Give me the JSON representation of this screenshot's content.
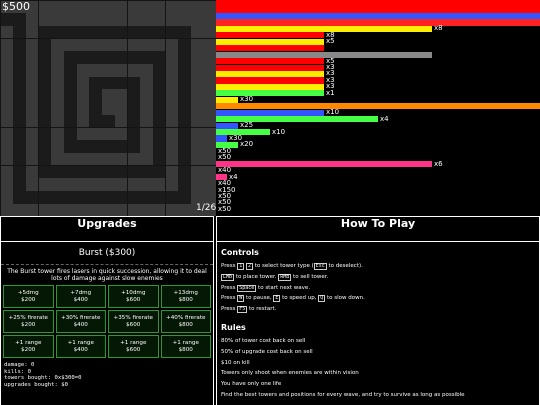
{
  "game": {
    "money": "$500",
    "wave_counter": "1/26"
  },
  "waves": [
    {
      "color": "#ff0000",
      "label": ""
    },
    {
      "color": "#ff0000",
      "label": ""
    },
    {
      "color": "#3355ff",
      "label": ""
    },
    {
      "color": "#ff2222",
      "label": ""
    },
    {
      "color": "#ffee00",
      "label": "x8"
    },
    {
      "color": "#ff0000",
      "label": "x8"
    },
    {
      "color": "#ffee00",
      "label": "x5"
    },
    {
      "color": "#ff0000",
      "label": ""
    },
    {
      "color": "#888888",
      "label": ""
    },
    {
      "color": "#ff0000",
      "label": "x5"
    },
    {
      "color": "#ff0000",
      "label": "x3"
    },
    {
      "color": "#ffee00",
      "label": "x3"
    },
    {
      "color": "#ff0000",
      "label": "x3"
    },
    {
      "color": "#ffee00",
      "label": "x3"
    },
    {
      "color": "#44ff44",
      "label": "x1"
    },
    {
      "color": "#ffee00",
      "label": "x30"
    },
    {
      "color": "#ff8800",
      "label": ""
    },
    {
      "color": "#3355ff",
      "label": "x10"
    },
    {
      "color": "#44ff44",
      "label": "x4"
    },
    {
      "color": "#3355ff",
      "label": "x25"
    },
    {
      "color": "#44ff44",
      "label": "x10"
    },
    {
      "color": "#3355ff",
      "label": "x30"
    },
    {
      "color": "#44ff44",
      "label": "x20"
    },
    {
      "color": "#3355ff",
      "label": "x50"
    },
    {
      "color": "#44ff44",
      "label": "x50"
    },
    {
      "color": "#ff3388",
      "label": "x6"
    },
    {
      "color": "#ffee00",
      "label": "x40"
    },
    {
      "color": "#ff3388",
      "label": "x4"
    },
    {
      "color": "#44ff44",
      "label": "x40"
    },
    {
      "color": "#3355ff",
      "label": "x150"
    },
    {
      "color": "#ff0000",
      "label": "x50"
    },
    {
      "color": "#ffee00",
      "label": "x50"
    },
    {
      "color": "#ffee00",
      "label": "x50"
    }
  ],
  "upgrades": {
    "title": "Upgrades",
    "tower_name": "Burst ($300)",
    "tower_desc": "The Burst tower fires lasers in quick succession, allowing it to deal lots of damage against slow enemies",
    "buttons": [
      {
        "line1": "+5dmg",
        "line2": "$200"
      },
      {
        "line1": "+7dmg",
        "line2": "$400"
      },
      {
        "line1": "+10dmg",
        "line2": "$600"
      },
      {
        "line1": "+13dmg",
        "line2": "$800"
      },
      {
        "line1": "+25% firerate",
        "line2": "$200"
      },
      {
        "line1": "+30% firerate",
        "line2": "$400"
      },
      {
        "line1": "+35% firerate",
        "line2": "$600"
      },
      {
        "line1": "+40% firerate",
        "line2": "$800"
      },
      {
        "line1": "+1 range",
        "line2": "$200"
      },
      {
        "line1": "+1 range",
        "line2": "$400"
      },
      {
        "line1": "+1 range",
        "line2": "$600"
      },
      {
        "line1": "+1 range",
        "line2": "$800"
      }
    ],
    "stats": {
      "damage": "damage: 0",
      "kills": "kills: 0",
      "towers_bought": "towers bought: 0x$300=0",
      "upgrades_bought": "upgrades bought: $0"
    }
  },
  "howto": {
    "title": "How To Play",
    "controls_heading": "Controls",
    "line1_pre": "Press",
    "line1_k1": "1",
    "line1_k2": "2",
    "line1_mid": "to select tower type (",
    "line1_k3": "Esc",
    "line1_post": "to deselect).",
    "line2_k1": "LMB",
    "line2_mid": "to place tower.",
    "line2_k2": "RMB",
    "line2_post": "to sell tower.",
    "line3_pre": "Press",
    "line3_k1": "Space",
    "line3_post": "to start next wave.",
    "line4_pre": "Press",
    "line4_k1": "W",
    "line4_mid1": "to pause,",
    "line4_k2": "E",
    "line4_mid2": "to speed up,",
    "line4_k3": "Q",
    "line4_post": "to slow down.",
    "line5_pre": "Press",
    "line5_k1": "F5",
    "line5_post": "to restart.",
    "rules_heading": "Rules",
    "rules": [
      "80% of tower cost back on sell",
      "50% of upgrade cost back on sell",
      "$10 on kill",
      "Towers only shoot when enemies are within vision",
      "You have only one life",
      "Find the best towers and positions for every wave, and try to survive as long as possible"
    ]
  }
}
